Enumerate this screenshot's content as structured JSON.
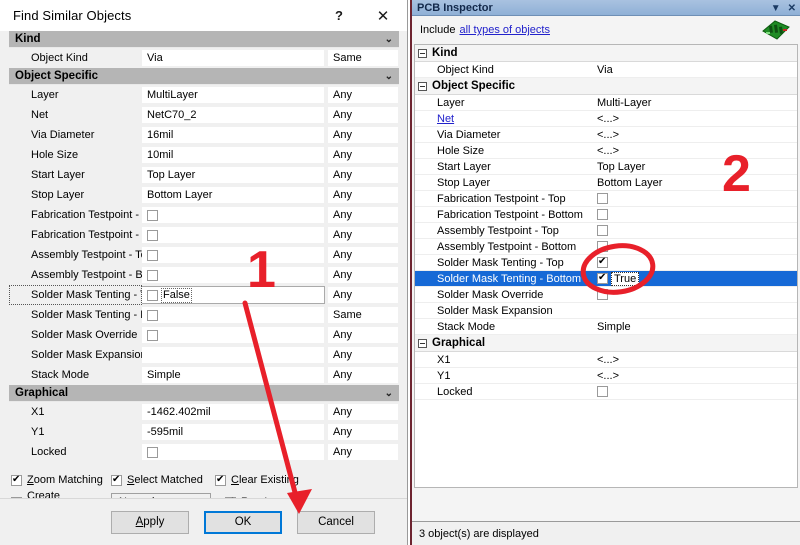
{
  "find_similar": {
    "title": "Find Similar Objects",
    "help_icon": "?",
    "close_icon": "✕",
    "sections": [
      {
        "name": "Kind",
        "rows": [
          {
            "label": "Object Kind",
            "value": "Via",
            "operator": "Same",
            "type": "text"
          }
        ]
      },
      {
        "name": "Object Specific",
        "rows": [
          {
            "label": "Layer",
            "value": "MultiLayer",
            "operator": "Any",
            "type": "text"
          },
          {
            "label": "Net",
            "value": "NetC70_2",
            "operator": "Any",
            "type": "text"
          },
          {
            "label": "Via Diameter",
            "value": "16mil",
            "operator": "Any",
            "type": "text"
          },
          {
            "label": "Hole Size",
            "value": "10mil",
            "operator": "Any",
            "type": "text"
          },
          {
            "label": "Start Layer",
            "value": "Top Layer",
            "operator": "Any",
            "type": "text"
          },
          {
            "label": "Stop Layer",
            "value": "Bottom Layer",
            "operator": "Any",
            "type": "text"
          },
          {
            "label": "Fabrication Testpoint - T",
            "value": "",
            "operator": "Any",
            "type": "checkbox",
            "checked": false
          },
          {
            "label": "Fabrication Testpoint - B",
            "value": "",
            "operator": "Any",
            "type": "checkbox",
            "checked": false
          },
          {
            "label": "Assembly Testpoint - Top",
            "value": "",
            "operator": "Any",
            "type": "checkbox",
            "checked": false
          },
          {
            "label": "Assembly Testpoint - Bot",
            "value": "",
            "operator": "Any",
            "type": "checkbox",
            "checked": false
          },
          {
            "label": "Solder Mask Tenting - T",
            "value": "False",
            "operator": "Any",
            "type": "checkbox",
            "checked": false,
            "focused": true
          },
          {
            "label": "Solder Mask Tenting - B",
            "value": "",
            "operator": "Same",
            "type": "checkbox",
            "checked": false
          },
          {
            "label": "Solder Mask Override",
            "value": "",
            "operator": "Any",
            "type": "checkbox",
            "checked": false
          },
          {
            "label": "Solder Mask Expansion",
            "value": "",
            "operator": "Any",
            "type": "text"
          },
          {
            "label": "Stack Mode",
            "value": "Simple",
            "operator": "Any",
            "type": "text"
          }
        ]
      },
      {
        "name": "Graphical",
        "rows": [
          {
            "label": "X1",
            "value": "-1462.402mil",
            "operator": "Any",
            "type": "text"
          },
          {
            "label": "Y1",
            "value": "-595mil",
            "operator": "Any",
            "type": "text"
          },
          {
            "label": "Locked",
            "value": "",
            "operator": "Any",
            "type": "checkbox",
            "checked": false
          }
        ]
      }
    ],
    "options": {
      "zoom_matching": "Zoom Matching",
      "zoom_matching_checked": true,
      "select_matched": "Select Matched",
      "select_matched_checked": true,
      "clear_existing": "Clear Existing",
      "clear_existing_checked": true,
      "create_expression": "Create Expression",
      "create_expression_checked": false,
      "run_inspector": "Run Inspector",
      "run_inspector_checked": true,
      "mode_selected": "Normal",
      "mode_options": [
        "Normal"
      ]
    },
    "buttons": {
      "apply": "Apply",
      "ok": "OK",
      "cancel": "Cancel"
    }
  },
  "inspector": {
    "title": "PCB Inspector",
    "dropdown_icon": "▼",
    "close_icon": "✕",
    "include_label": "Include",
    "include_link": "all types of objects",
    "sections": [
      {
        "name": "Kind",
        "rows": [
          {
            "label": "Object Kind",
            "value": "Via",
            "type": "text"
          }
        ]
      },
      {
        "name": "Object Specific",
        "rows": [
          {
            "label": "Layer",
            "value": "Multi-Layer",
            "type": "text"
          },
          {
            "label": "Net",
            "value": "<...>",
            "type": "text",
            "link": true
          },
          {
            "label": "Via Diameter",
            "value": "<...>",
            "type": "text"
          },
          {
            "label": "Hole Size",
            "value": "<...>",
            "type": "text"
          },
          {
            "label": "Start Layer",
            "value": "Top Layer",
            "type": "text"
          },
          {
            "label": "Stop Layer",
            "value": "Bottom Layer",
            "type": "text"
          },
          {
            "label": "Fabrication Testpoint - Top",
            "value": "",
            "type": "checkbox",
            "checked": false
          },
          {
            "label": "Fabrication Testpoint - Bottom",
            "value": "",
            "type": "checkbox",
            "checked": false
          },
          {
            "label": "Assembly Testpoint - Top",
            "value": "",
            "type": "checkbox",
            "checked": false
          },
          {
            "label": "Assembly Testpoint - Bottom",
            "value": "",
            "type": "checkbox",
            "checked": false
          },
          {
            "label": "Solder Mask Tenting - Top",
            "value": "",
            "type": "checkbox",
            "checked": true
          },
          {
            "label": "Solder Mask Tenting - Bottom",
            "value": "True",
            "type": "checkbox",
            "checked": true,
            "selected": true
          },
          {
            "label": "Solder Mask Override",
            "value": "",
            "type": "checkbox",
            "checked": false
          },
          {
            "label": "Solder Mask Expansion",
            "value": "",
            "type": "text"
          },
          {
            "label": "Stack Mode",
            "value": "Simple",
            "type": "text"
          }
        ]
      },
      {
        "name": "Graphical",
        "rows": [
          {
            "label": "X1",
            "value": "<...>",
            "type": "text"
          },
          {
            "label": "Y1",
            "value": "<...>",
            "type": "text"
          },
          {
            "label": "Locked",
            "value": "",
            "type": "checkbox",
            "checked": false
          }
        ]
      }
    ],
    "status": "3 object(s) are displayed"
  },
  "annotations": {
    "step1": "1",
    "step2": "2",
    "accent_color": "#e8202a"
  }
}
